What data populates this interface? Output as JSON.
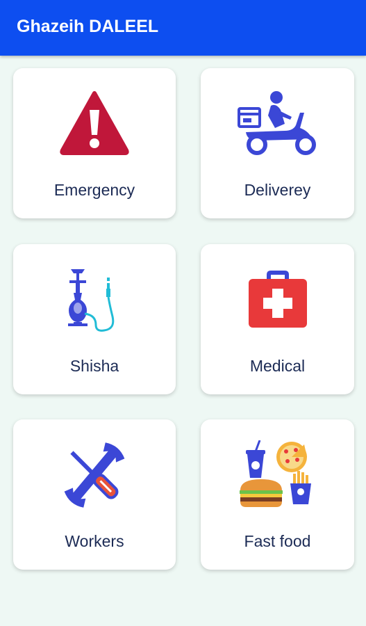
{
  "appbar": {
    "title": "Ghazeih DALEEL"
  },
  "colors": {
    "appbar": "#0d4ef0",
    "background": "#eef8f4",
    "label": "#1c2b55"
  },
  "categories": [
    {
      "label": "Emergency",
      "icon": "warning-icon"
    },
    {
      "label": "Deliverey",
      "icon": "delivery-scooter-icon"
    },
    {
      "label": "Shisha",
      "icon": "hookah-icon"
    },
    {
      "label": "Medical",
      "icon": "first-aid-kit-icon"
    },
    {
      "label": "Workers",
      "icon": "wrench-screwdriver-icon"
    },
    {
      "label": "Fast food",
      "icon": "fast-food-icon"
    }
  ]
}
